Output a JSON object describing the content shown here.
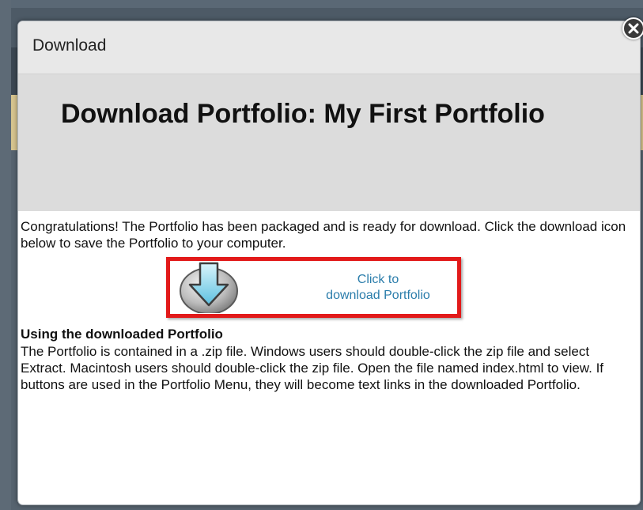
{
  "modal": {
    "title": "Download",
    "heading": "Download Portfolio: My First Portfolio",
    "intro": "Congratulations! The Portfolio has been packaged and is ready for download. Click the download icon below to save the Portfolio to your computer.",
    "download": {
      "line1": "Click to",
      "line2": "download Portfolio",
      "icon": "download-arrow-icon"
    },
    "section_heading": "Using the downloaded Portfolio",
    "section_body": "The Portfolio is contained in a .zip file. Windows users should double-click the zip file and select Extract. Macintosh users should double-click the zip file. Open the file named index.html to view. If buttons are used in the Portfolio Menu, they will become text links in the downloaded Portfolio.",
    "close_icon": "close-icon"
  },
  "colors": {
    "highlight_border": "#e21a1a",
    "link": "#2b7dab",
    "heading_panel": "#dcdcdc",
    "titlebar": "#e8e8e8"
  }
}
